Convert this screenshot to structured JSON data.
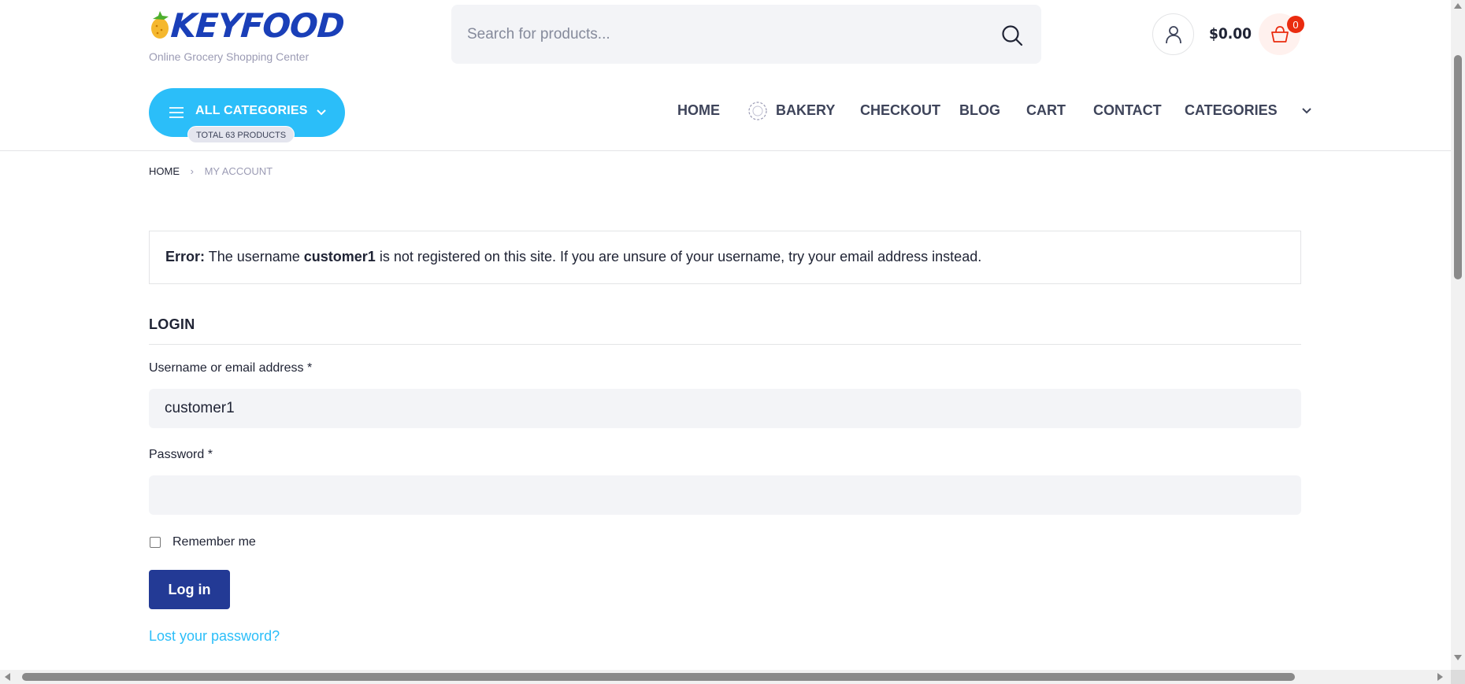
{
  "brand": {
    "name": "KEYFOOD",
    "tagline": "Online Grocery Shopping Center",
    "color": "#1a3fb8"
  },
  "search": {
    "placeholder": "Search for products...",
    "value": ""
  },
  "cart": {
    "total": "$0.00",
    "count": "0"
  },
  "categories_button": {
    "label": "ALL CATEGORIES",
    "badge": "TOTAL 63 PRODUCTS"
  },
  "nav": {
    "items": [
      {
        "label": "HOME"
      },
      {
        "label": "BAKERY",
        "icon": "bakery-icon"
      },
      {
        "label": "CHECKOUT"
      },
      {
        "label": "BLOG"
      },
      {
        "label": "CART"
      },
      {
        "label": "CONTACT"
      },
      {
        "label": "CATEGORIES",
        "icon": "chevron-down-icon"
      }
    ]
  },
  "breadcrumb": {
    "home": "HOME",
    "current": "MY ACCOUNT"
  },
  "error": {
    "prefix": "Error:",
    "text_1": "The username",
    "username": "customer1",
    "text_2": "is not registered on this site. If you are unsure of your username, try your email address instead."
  },
  "login": {
    "title": "LOGIN",
    "username_label": "Username or email address *",
    "username_value": "customer1",
    "password_label": "Password *",
    "password_value": "",
    "remember_label": "Remember me",
    "remember_checked": false,
    "submit_label": "Log in",
    "lost_password": "Lost your password?"
  },
  "colors": {
    "accent": "#2bbef9",
    "primary_button": "#233a95",
    "cart_badge": "#ea2b0f",
    "input_bg": "#f3f4f7"
  }
}
